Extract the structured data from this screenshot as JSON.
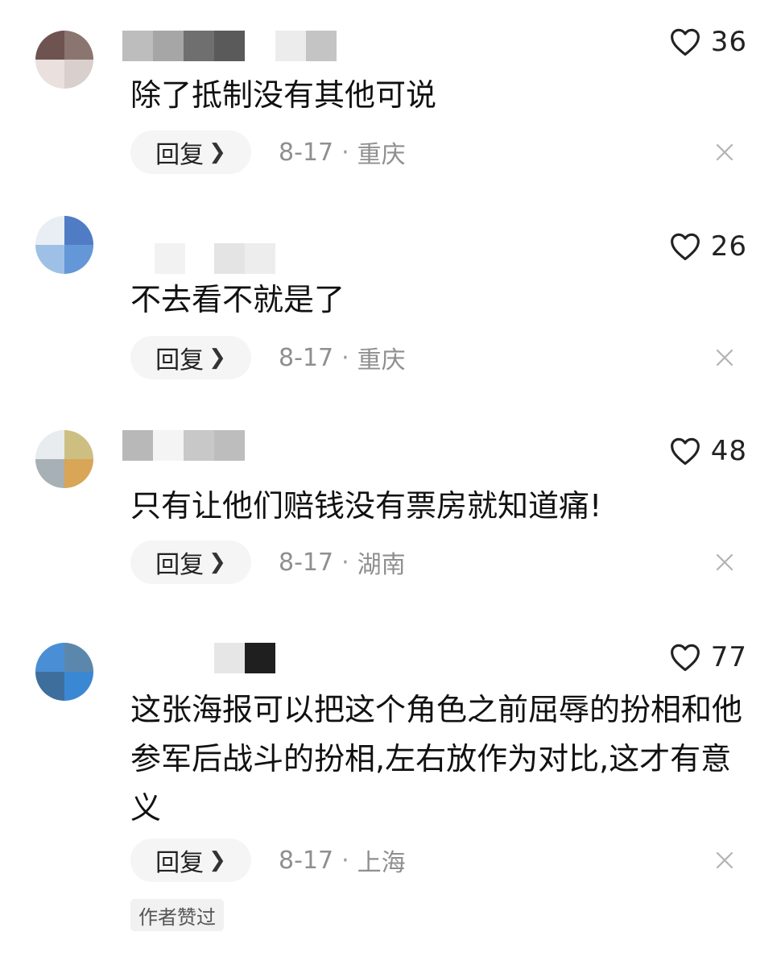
{
  "comments": [
    {
      "likes": "36",
      "text": "除了抵制没有其他可说",
      "reply_label": "回复",
      "date": "8-17",
      "location": "重庆",
      "separator": "·"
    },
    {
      "likes": "26",
      "text": "不去看不就是了",
      "reply_label": "回复",
      "date": "8-17",
      "location": "重庆",
      "separator": "·"
    },
    {
      "likes": "48",
      "text": "只有让他们赔钱没有票房就知道痛!",
      "reply_label": "回复",
      "date": "8-17",
      "location": "湖南",
      "separator": "·"
    },
    {
      "likes": "77",
      "text": "这张海报可以把这个角色之前屈辱的扮相和他参军后战斗的扮相,左右放作为对比,这才有意义",
      "reply_label": "回复",
      "date": "8-17",
      "location": "上海",
      "separator": "·",
      "badge": "作者赞过"
    }
  ],
  "icons": {
    "like": "heart-outline-icon",
    "reply_arrow": "chevron-right-icon",
    "close": "close-icon"
  },
  "colors": {
    "text": "#111111",
    "meta": "#8f8f8f",
    "reply_bg": "#f5f5f5",
    "badge_bg": "#f1f1f1"
  }
}
